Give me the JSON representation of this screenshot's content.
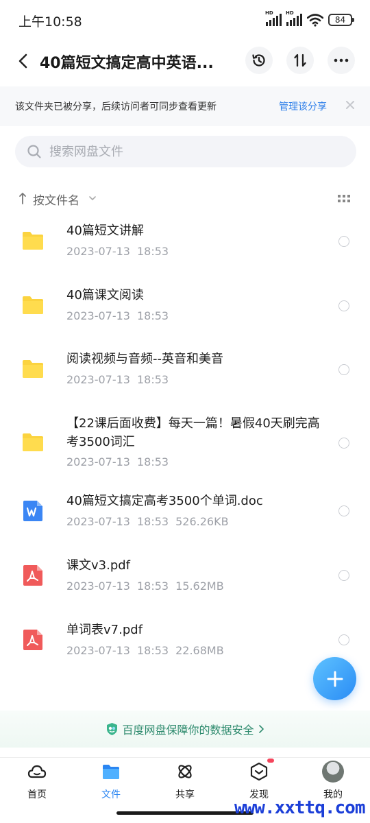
{
  "status_bar": {
    "time": "上午10:58",
    "signal_label": "HD",
    "battery": "84"
  },
  "header": {
    "title": "40篇短文搞定高中英语...",
    "back_icon": "back-arrow-icon",
    "history_icon": "history-icon",
    "sort_icon": "sort-icon",
    "more_icon": "more-icon"
  },
  "share_banner": {
    "text": "该文件夹已被分享，后续访问者可同步查看更新",
    "link": "管理该分享"
  },
  "search": {
    "placeholder": "搜索网盘文件"
  },
  "sort": {
    "label": "按文件名"
  },
  "files": [
    {
      "name": "40篇短文讲解",
      "date": "2023-07-13",
      "time": "18:53",
      "size": "",
      "type": "folder"
    },
    {
      "name": "40篇课文阅读",
      "date": "2023-07-13",
      "time": "18:53",
      "size": "",
      "type": "folder"
    },
    {
      "name": "阅读视频与音频--英音和美音",
      "date": "2023-07-13",
      "time": "18:53",
      "size": "",
      "type": "folder"
    },
    {
      "name": "【22课后面收费】每天一篇！暑假40天刷完高考3500词汇",
      "date": "2023-07-13",
      "time": "18:53",
      "size": "",
      "type": "folder"
    },
    {
      "name": "40篇短文搞定高考3500个单词.doc",
      "date": "2023-07-13",
      "time": "18:53",
      "size": "526.26KB",
      "type": "doc"
    },
    {
      "name": "课文v3.pdf",
      "date": "2023-07-13",
      "time": "18:53",
      "size": "15.62MB",
      "type": "pdf"
    },
    {
      "name": "单词表v7.pdf",
      "date": "2023-07-13",
      "time": "18:53",
      "size": "22.68MB",
      "type": "pdf"
    }
  ],
  "safety": {
    "text": "百度网盘保障你的数据安全"
  },
  "tabs": [
    {
      "label": "首页",
      "icon": "cloud-icon",
      "active": false
    },
    {
      "label": "文件",
      "icon": "folder-icon",
      "active": true
    },
    {
      "label": "共享",
      "icon": "atom-icon",
      "active": false
    },
    {
      "label": "发现",
      "icon": "discover-icon",
      "active": false
    },
    {
      "label": "我的",
      "icon": "avatar",
      "active": false
    }
  ],
  "watermark": "www.xxttq.com",
  "colors": {
    "accent": "#2b86f2",
    "folder": "#fbd33f",
    "doc": "#3b86f4",
    "pdf": "#f05a5a",
    "safety": "#2d8a6d"
  }
}
